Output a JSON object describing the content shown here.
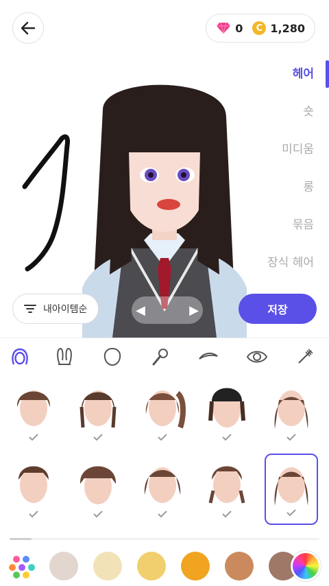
{
  "header": {
    "gems": "0",
    "coin_symbol": "C",
    "coins": "1,280"
  },
  "categories": [
    {
      "label": "헤어",
      "active": true
    },
    {
      "label": "숏",
      "active": false
    },
    {
      "label": "미디움",
      "active": false
    },
    {
      "label": "롱",
      "active": false
    },
    {
      "label": "묶음",
      "active": false
    },
    {
      "label": "장식 헤어",
      "active": false
    }
  ],
  "sort_button": {
    "label": "내아이템순"
  },
  "save_button": {
    "label": "저장"
  },
  "tabs": [
    "hair-icon",
    "bunny-ears-icon",
    "face-shape-icon",
    "microphone-icon",
    "eyebrow-icon",
    "eye-icon",
    "mascara-icon"
  ],
  "hair_items": [
    {
      "name": "short-bowl"
    },
    {
      "name": "braided-pigtails"
    },
    {
      "name": "wavy-ponytail"
    },
    {
      "name": "beanie-bob"
    },
    {
      "name": "long-side-bangs"
    },
    {
      "name": "slicked-short"
    },
    {
      "name": "short-fluffy"
    },
    {
      "name": "curly-bob"
    },
    {
      "name": "low-pigtails"
    },
    {
      "name": "long-straight-bangs",
      "selected": true
    }
  ],
  "colors": {
    "accent": "#5a4fe6",
    "hair_brown": "#6b4636",
    "swatches": [
      "#e2d6ce",
      "#f2e2b8",
      "#f1cf6e",
      "#f0a420",
      "#cb8a5e",
      "#a07868"
    ]
  }
}
